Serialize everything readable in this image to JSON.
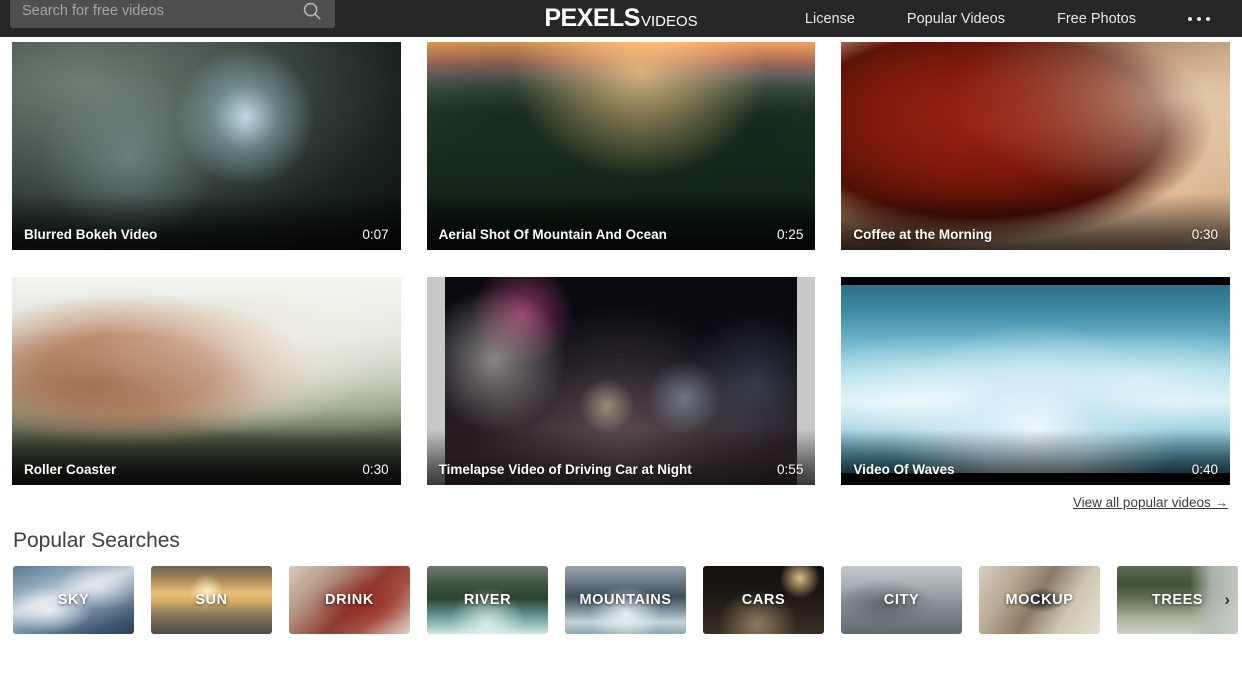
{
  "header": {
    "search": {
      "placeholder": "Search for free videos",
      "value": "",
      "icon": "search-icon"
    },
    "logo": {
      "main": "PEXELS",
      "sub": "VIDEOS"
    },
    "nav": [
      {
        "label": "License"
      },
      {
        "label": "Popular Videos"
      },
      {
        "label": "Free Photos"
      }
    ],
    "more_icon": "ellipsis-icon",
    "background_color": "#262626"
  },
  "videos": [
    {
      "title": "Blurred Bokeh Video",
      "duration": "0:07",
      "art": "th-bokeh",
      "fit": "cover"
    },
    {
      "title": "Aerial Shot Of Mountain And Ocean",
      "duration": "0:25",
      "art": "th-aerial",
      "fit": "cover"
    },
    {
      "title": "Coffee at the Morning",
      "duration": "0:30",
      "art": "th-coffee",
      "fit": "cover"
    },
    {
      "title": "Roller Coaster",
      "duration": "0:30",
      "art": "th-roller",
      "fit": "cover"
    },
    {
      "title": "Timelapse Video of Driving Car at Night",
      "duration": "0:55",
      "art": "th-night",
      "fit": "pillarbox"
    },
    {
      "title": "Video Of Waves",
      "duration": "0:40",
      "art": "th-waves",
      "fit": "letterbox"
    }
  ],
  "view_all": {
    "label": "View all popular videos →"
  },
  "popular_searches": {
    "title": "Popular Searches",
    "next_arrow": "›",
    "tiles": [
      {
        "label": "SKY",
        "art": "ti-sky"
      },
      {
        "label": "SUN",
        "art": "ti-sun"
      },
      {
        "label": "DRINK",
        "art": "ti-drink"
      },
      {
        "label": "RIVER",
        "art": "ti-river"
      },
      {
        "label": "MOUNTAINS",
        "art": "ti-mountains"
      },
      {
        "label": "CARS",
        "art": "ti-cars"
      },
      {
        "label": "CITY",
        "art": "ti-city"
      },
      {
        "label": "MOCKUP",
        "art": "ti-mockup"
      },
      {
        "label": "TREES",
        "art": "ti-trees"
      }
    ]
  }
}
